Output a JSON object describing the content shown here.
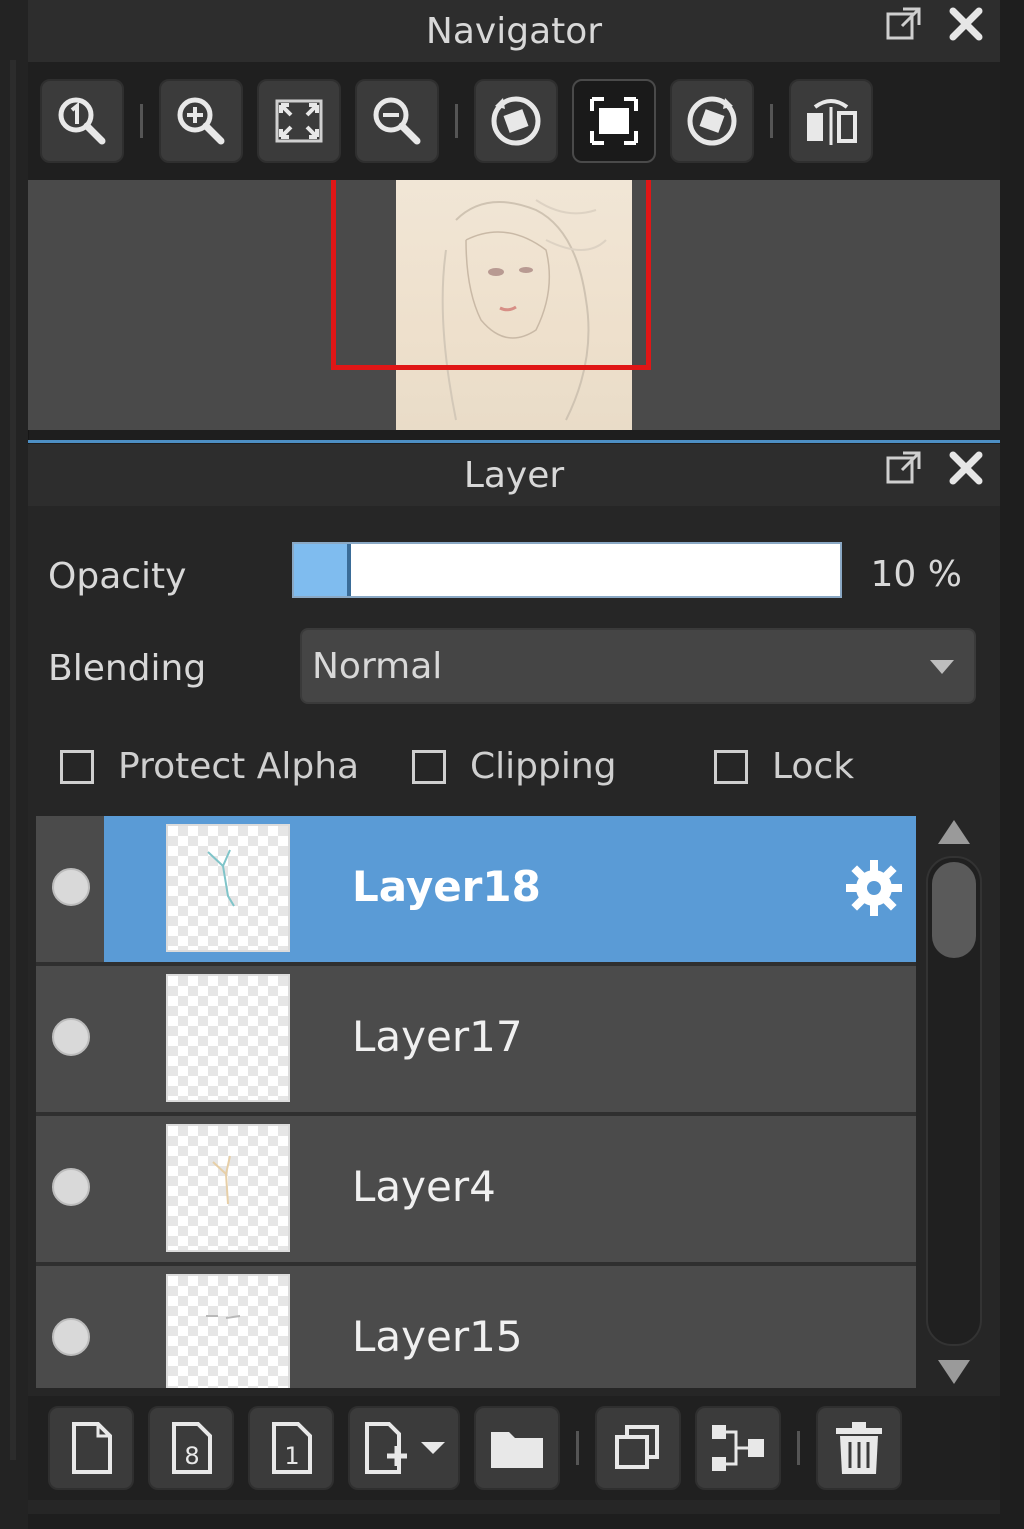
{
  "navigator": {
    "title": "Navigator",
    "toolbar": {
      "buttons": [
        {
          "name": "zoom-actual-size",
          "icon": "zoom-1-icon"
        },
        {
          "name": "zoom-in",
          "icon": "zoom-in-icon"
        },
        {
          "name": "fit-window",
          "icon": "fit-icon"
        },
        {
          "name": "zoom-out",
          "icon": "zoom-out-icon"
        },
        {
          "name": "rotate-left",
          "icon": "rotate-left-icon"
        },
        {
          "name": "reset-view",
          "icon": "frame-icon"
        },
        {
          "name": "rotate-right",
          "icon": "rotate-right-icon"
        },
        {
          "name": "flip-horizontal",
          "icon": "flip-icon"
        }
      ]
    }
  },
  "layer_panel": {
    "title": "Layer",
    "opacity_label": "Opacity",
    "opacity_value": "10 %",
    "opacity_fraction": 0.1,
    "blending_label": "Blending",
    "blending_value": "Normal",
    "checkboxes": {
      "protect_alpha": "Protect Alpha",
      "clipping": "Clipping",
      "lock": "Lock"
    },
    "layers": [
      {
        "name": "Layer18",
        "selected": true
      },
      {
        "name": "Layer17",
        "selected": false
      },
      {
        "name": "Layer4",
        "selected": false
      },
      {
        "name": "Layer15",
        "selected": false
      }
    ],
    "selected_color": "#5a9bd6",
    "accent_blue": "#4d8fc4",
    "viewport_rect_color": "#e01616"
  }
}
